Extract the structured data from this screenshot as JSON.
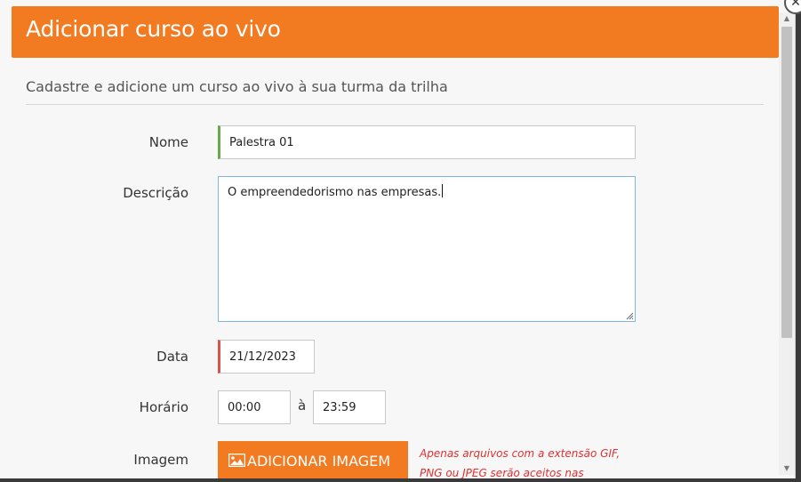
{
  "modal": {
    "title": "Adicionar curso ao vivo",
    "subtitle": "Cadastre e adicione um curso ao vivo à sua turma da trilha"
  },
  "form": {
    "nome_label": "Nome",
    "nome_value": "Palestra 01",
    "descricao_label": "Descrição",
    "descricao_value": "O empreendedorismo nas empresas.",
    "data_label": "Data",
    "data_value": "21/12/2023",
    "horario_label": "Horário",
    "horario_start": "00:00",
    "horario_separator": "à",
    "horario_end": "23:59",
    "imagem_label": "Imagem",
    "add_image_button": "ADICIONAR IMAGEM",
    "image_hint": "Apenas arquivos com a extensão GIF, PNG ou JPEG serão aceitos nas proporções"
  },
  "icons": {
    "close": "close-icon",
    "image": "image-icon",
    "scroll_up": "chevron-up-icon",
    "scroll_down": "chevron-down-icon"
  },
  "colors": {
    "accent": "#f27a21",
    "valid_border": "#6aa84f",
    "invalid_border": "#d9534f",
    "hint_text": "#e03030"
  }
}
